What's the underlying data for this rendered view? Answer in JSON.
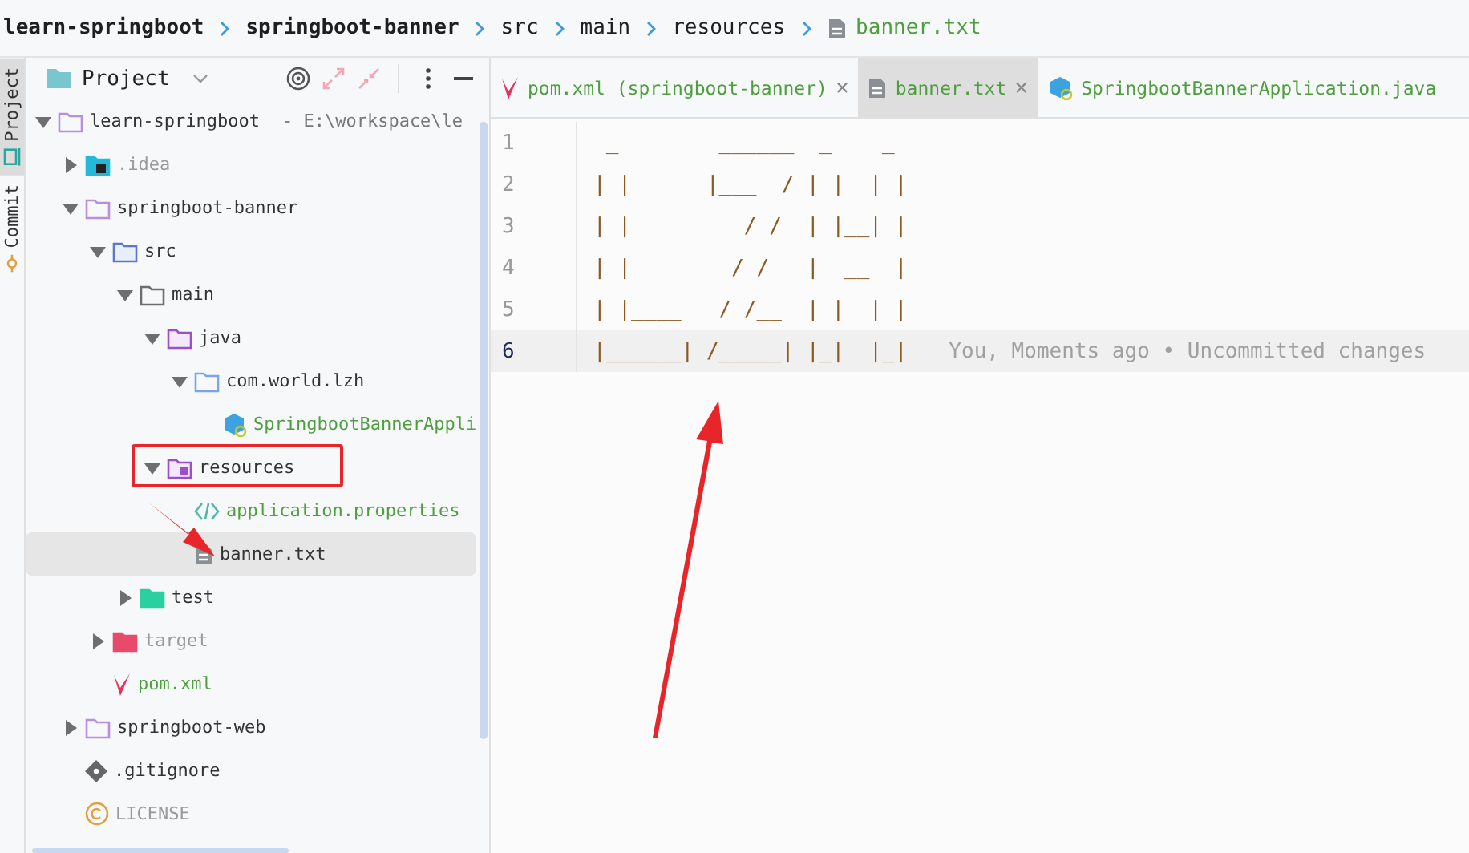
{
  "breadcrumbs": [
    {
      "label": "learn-springboot",
      "kind": "module"
    },
    {
      "label": "springboot-banner",
      "kind": "module"
    },
    {
      "label": "src",
      "kind": "folder"
    },
    {
      "label": "main",
      "kind": "folder"
    },
    {
      "label": "resources",
      "kind": "folder"
    },
    {
      "label": "banner.txt",
      "kind": "file"
    }
  ],
  "side_strip": [
    {
      "label": "Project",
      "selected": true,
      "kind": "project"
    },
    {
      "label": "Commit",
      "selected": false,
      "kind": "commit"
    }
  ],
  "project_panel": {
    "title": "Project"
  },
  "tree": [
    {
      "label": "learn-springboot",
      "path": "- E:\\workspace\\le",
      "kind": "module",
      "added": false,
      "ignored": false,
      "expanded": true,
      "selected": false,
      "children": [
        {
          "label": ".idea",
          "kind": "idea",
          "added": false,
          "ignored": true,
          "expanded": false,
          "selected": false
        },
        {
          "label": "springboot-banner",
          "kind": "module",
          "added": false,
          "ignored": false,
          "expanded": true,
          "selected": false,
          "children": [
            {
              "label": "src",
              "kind": "src",
              "added": false,
              "ignored": false,
              "expanded": true,
              "selected": false,
              "children": [
                {
                  "label": "main",
                  "kind": "folder",
                  "added": false,
                  "ignored": false,
                  "expanded": true,
                  "selected": false,
                  "children": [
                    {
                      "label": "java",
                      "kind": "java",
                      "added": false,
                      "ignored": false,
                      "expanded": true,
                      "selected": false,
                      "children": [
                        {
                          "label": "com.world.lzh",
                          "kind": "package",
                          "added": false,
                          "ignored": false,
                          "expanded": true,
                          "selected": false,
                          "children": [
                            {
                              "label": "SpringbootBannerAppli",
                              "kind": "class",
                              "added": true,
                              "ignored": false,
                              "selected": false
                            }
                          ]
                        }
                      ]
                    },
                    {
                      "label": "resources",
                      "kind": "resources",
                      "added": false,
                      "ignored": false,
                      "expanded": true,
                      "selected": false,
                      "children": [
                        {
                          "label": "application.properties",
                          "kind": "properties",
                          "added": true,
                          "ignored": false,
                          "selected": false
                        },
                        {
                          "label": "banner.txt",
                          "kind": "text",
                          "added": false,
                          "ignored": false,
                          "selected": true
                        }
                      ]
                    }
                  ]
                },
                {
                  "label": "test",
                  "kind": "test",
                  "added": false,
                  "ignored": false,
                  "expanded": false,
                  "selected": false
                }
              ]
            },
            {
              "label": "target",
              "kind": "target",
              "added": false,
              "ignored": true,
              "expanded": false,
              "selected": false
            },
            {
              "label": "pom.xml",
              "kind": "maven",
              "added": true,
              "ignored": false,
              "selected": false
            }
          ]
        },
        {
          "label": "springboot-web",
          "kind": "module",
          "added": false,
          "ignored": false,
          "expanded": false,
          "selected": false
        },
        {
          "label": ".gitignore",
          "kind": "git",
          "added": false,
          "ignored": false,
          "selected": false
        },
        {
          "label": "LICENSE",
          "kind": "license",
          "added": false,
          "ignored": true,
          "selected": false
        }
      ]
    }
  ],
  "editor_tabs": [
    {
      "label": "pom.xml (springboot-banner)",
      "kind": "maven",
      "selected": false,
      "close": "×"
    },
    {
      "label": "banner.txt",
      "kind": "text",
      "selected": true,
      "close": "×"
    },
    {
      "label": "SpringbootBannerApplication.java",
      "kind": "class",
      "selected": false
    }
  ],
  "editor": {
    "lines": [
      {
        "number": "1",
        "text": " _        ______  _    _ ",
        "current": false
      },
      {
        "number": "2",
        "text": "| |      |___  / | |  | |",
        "current": false
      },
      {
        "number": "3",
        "text": "| |         / /  | |__| |",
        "current": false
      },
      {
        "number": "4",
        "text": "| |        / /   |  __  |",
        "current": false
      },
      {
        "number": "5",
        "text": "| |____   / /__  | |  | |",
        "current": false
      },
      {
        "number": "6",
        "text": "|______| /_____| |_|  |_|",
        "current": true,
        "blame": "You, Moments ago • Uncommitted changes"
      }
    ]
  }
}
